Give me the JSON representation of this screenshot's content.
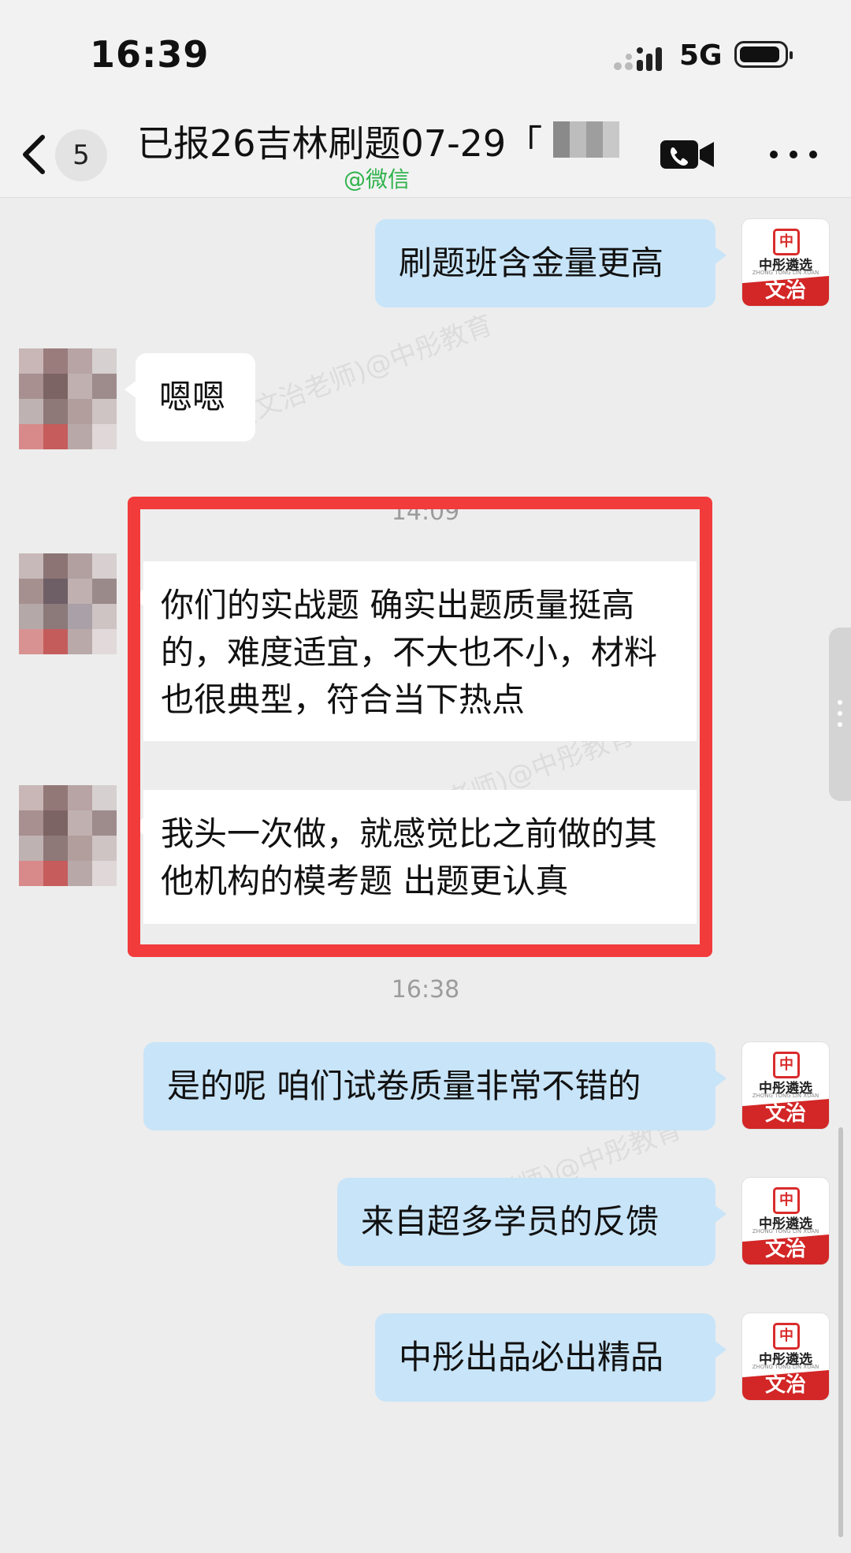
{
  "status_bar": {
    "time": "16:39",
    "network": "5G"
  },
  "nav": {
    "unread_count": "5",
    "title": "已报26吉林刷题07-29「",
    "subtitle": "@微信"
  },
  "messages": [
    {
      "side": "right",
      "text": "刷题班含金量更高"
    },
    {
      "side": "left",
      "text": "嗯嗯"
    },
    {
      "type": "time",
      "text": "14:09"
    },
    {
      "side": "left",
      "text": "你们的实战题 确实出题质量挺高的，难度适宜，不大也不小，材料也很典型，符合当下热点"
    },
    {
      "side": "left",
      "text": "我头一次做，就感觉比之前做的其他机构的模考题  出题更认真"
    },
    {
      "type": "time",
      "text": "16:38"
    },
    {
      "side": "right",
      "text": "是的呢 咱们试卷质量非常不错的"
    },
    {
      "side": "right",
      "text": "来自超多学员的反馈"
    },
    {
      "side": "right",
      "text": "中彤出品必出精品"
    }
  ],
  "teacher_avatar": {
    "brand": "中彤遴选",
    "sub": "ZHONG TONG LIN XUAN",
    "name": "文治"
  },
  "watermark": "(文治老师)@中彤教育",
  "colors": {
    "right_bubble": "#c8e4f8",
    "highlight": "#f23b3b",
    "wechat_green": "#2fb34c"
  }
}
